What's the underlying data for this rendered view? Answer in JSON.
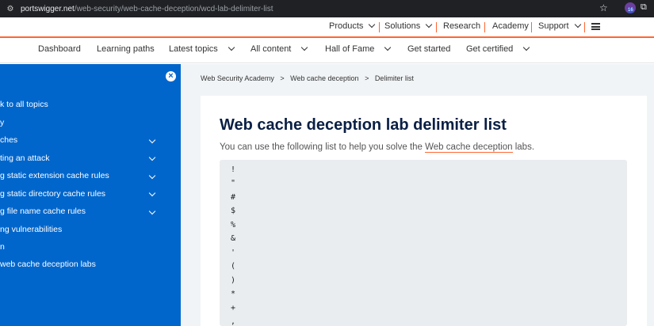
{
  "browser": {
    "url_host": "portswigger.net",
    "url_path": "/web-security/web-cache-deception/wcd-lab-delimiter-list",
    "ext_badge": "16"
  },
  "top_nav": {
    "products": "Products",
    "solutions": "Solutions",
    "research": "Research",
    "academy": "Academy",
    "support": "Support"
  },
  "main_nav": {
    "dashboard": "Dashboard",
    "learning_paths": "Learning paths",
    "latest_topics": "Latest topics",
    "all_content": "All content",
    "hall_of_fame": "Hall of Fame",
    "get_started": "Get started",
    "get_certified": "Get certified"
  },
  "sidebar": {
    "items": [
      {
        "label": "k to all topics"
      },
      {
        "label": "y"
      },
      {
        "label": "ches"
      },
      {
        "label": "ting an attack"
      },
      {
        "label": "g static extension cache rules"
      },
      {
        "label": "g static directory cache rules"
      },
      {
        "label": "g file name cache rules"
      },
      {
        "label": "ng vulnerabilities"
      },
      {
        "label": "n"
      },
      {
        "label": "web cache deception labs"
      }
    ]
  },
  "breadcrumb": {
    "item1": "Web Security Academy",
    "sep": ">",
    "item2": "Web cache deception",
    "item3": "Delimiter list"
  },
  "main": {
    "title": "Web cache deception lab delimiter list",
    "intro_prefix": "You can use the following list to help you solve the ",
    "intro_link": "Web cache deception",
    "intro_suffix": " labs.",
    "delimiters": [
      "!",
      "\"",
      "#",
      "$",
      "%",
      "&",
      "'",
      "(",
      ")",
      "*",
      "+",
      ","
    ]
  }
}
